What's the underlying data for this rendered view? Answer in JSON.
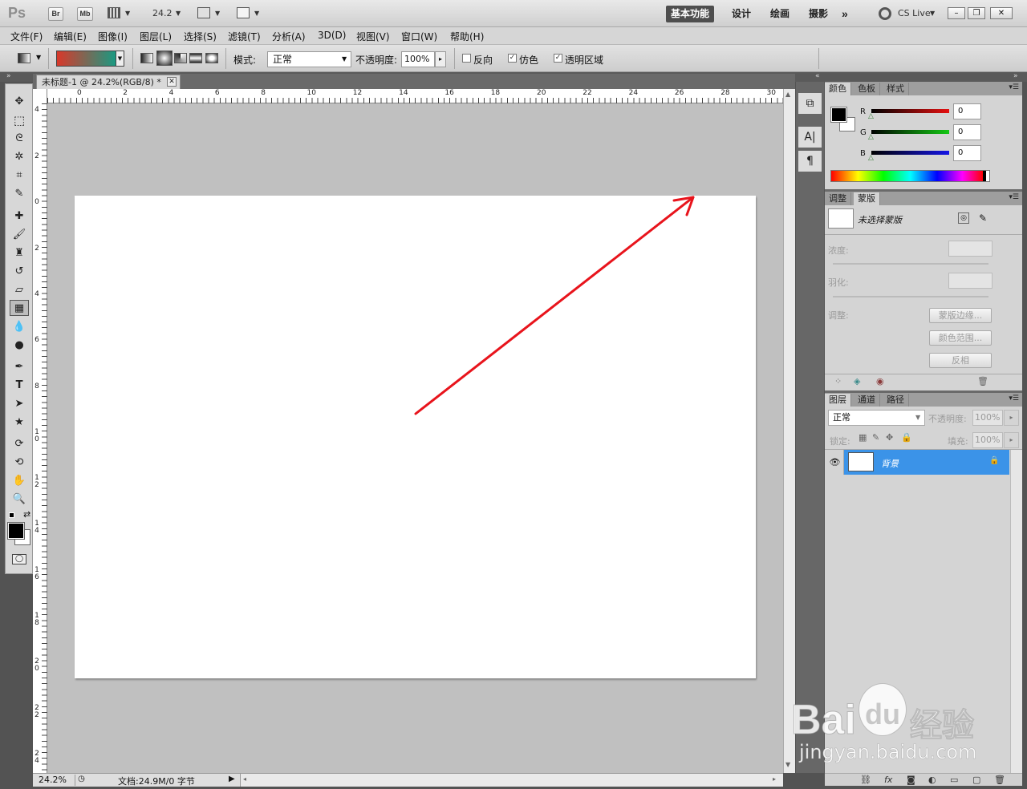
{
  "appbar": {
    "logo": "Ps",
    "br": "Br",
    "mb": "Mb",
    "zoom": "24.2",
    "workspaces": [
      "基本功能",
      "设计",
      "绘画",
      "摄影"
    ],
    "more": "»",
    "cs_live": "CS Live"
  },
  "menu": [
    "文件(F)",
    "编辑(E)",
    "图像(I)",
    "图层(L)",
    "选择(S)",
    "滤镜(T)",
    "分析(A)",
    "3D(D)",
    "视图(V)",
    "窗口(W)",
    "帮助(H)"
  ],
  "options": {
    "mode_label": "模式:",
    "mode_value": "正常",
    "opacity_label": "不透明度:",
    "opacity_value": "100%",
    "reverse_label": "反向",
    "dither_label": "仿色",
    "transparency_label": "透明区域",
    "gradient_start": "#d9382a",
    "gradient_end": "#1a9a82"
  },
  "document": {
    "tab_title": "未标题-1 @ 24.2%(RGB/8) *",
    "ruler_top": [
      "0",
      "2",
      "4",
      "6",
      "8",
      "10",
      "12",
      "14",
      "16",
      "18",
      "20",
      "22",
      "24",
      "26",
      "28",
      "30"
    ],
    "ruler_left_neg": "4",
    "ruler_left": [
      "2",
      "0",
      "2",
      "4",
      "6",
      "8",
      "10",
      "12",
      "14",
      "16",
      "18",
      "20",
      "22",
      "24"
    ],
    "status_zoom": "24.2%",
    "status_doc": "文档:24.9M/0 字节",
    "annotation_color": "#e8141c"
  },
  "color_panel": {
    "tabs": [
      "颜色",
      "色板",
      "样式"
    ],
    "channels": [
      {
        "name": "R",
        "value": "0",
        "color": "#e51010"
      },
      {
        "name": "G",
        "value": "0",
        "color": "#14c814"
      },
      {
        "name": "B",
        "value": "0",
        "color": "#1414e6"
      }
    ]
  },
  "masks_panel": {
    "tabs": [
      "调整",
      "蒙版"
    ],
    "title": "未选择蒙版",
    "density_label": "浓度:",
    "feather_label": "羽化:",
    "adjust_label": "调整:",
    "btn_edge": "蒙版边缘...",
    "btn_range": "颜色范围...",
    "btn_invert": "反相"
  },
  "layers_panel": {
    "tabs": [
      "图层",
      "通道",
      "路径"
    ],
    "blend_mode": "正常",
    "opacity_label": "不透明度:",
    "opacity_value": "100%",
    "lock_label": "锁定:",
    "fill_label": "填充:",
    "fill_value": "100%",
    "layers": [
      {
        "name": "背景",
        "selected": true,
        "locked": true
      }
    ],
    "selected_color": "#3b93e8"
  },
  "watermark": {
    "brand": "Bai",
    "brand2": "du",
    "jingyan": "经验",
    "url": "jingyan.baidu.com"
  }
}
